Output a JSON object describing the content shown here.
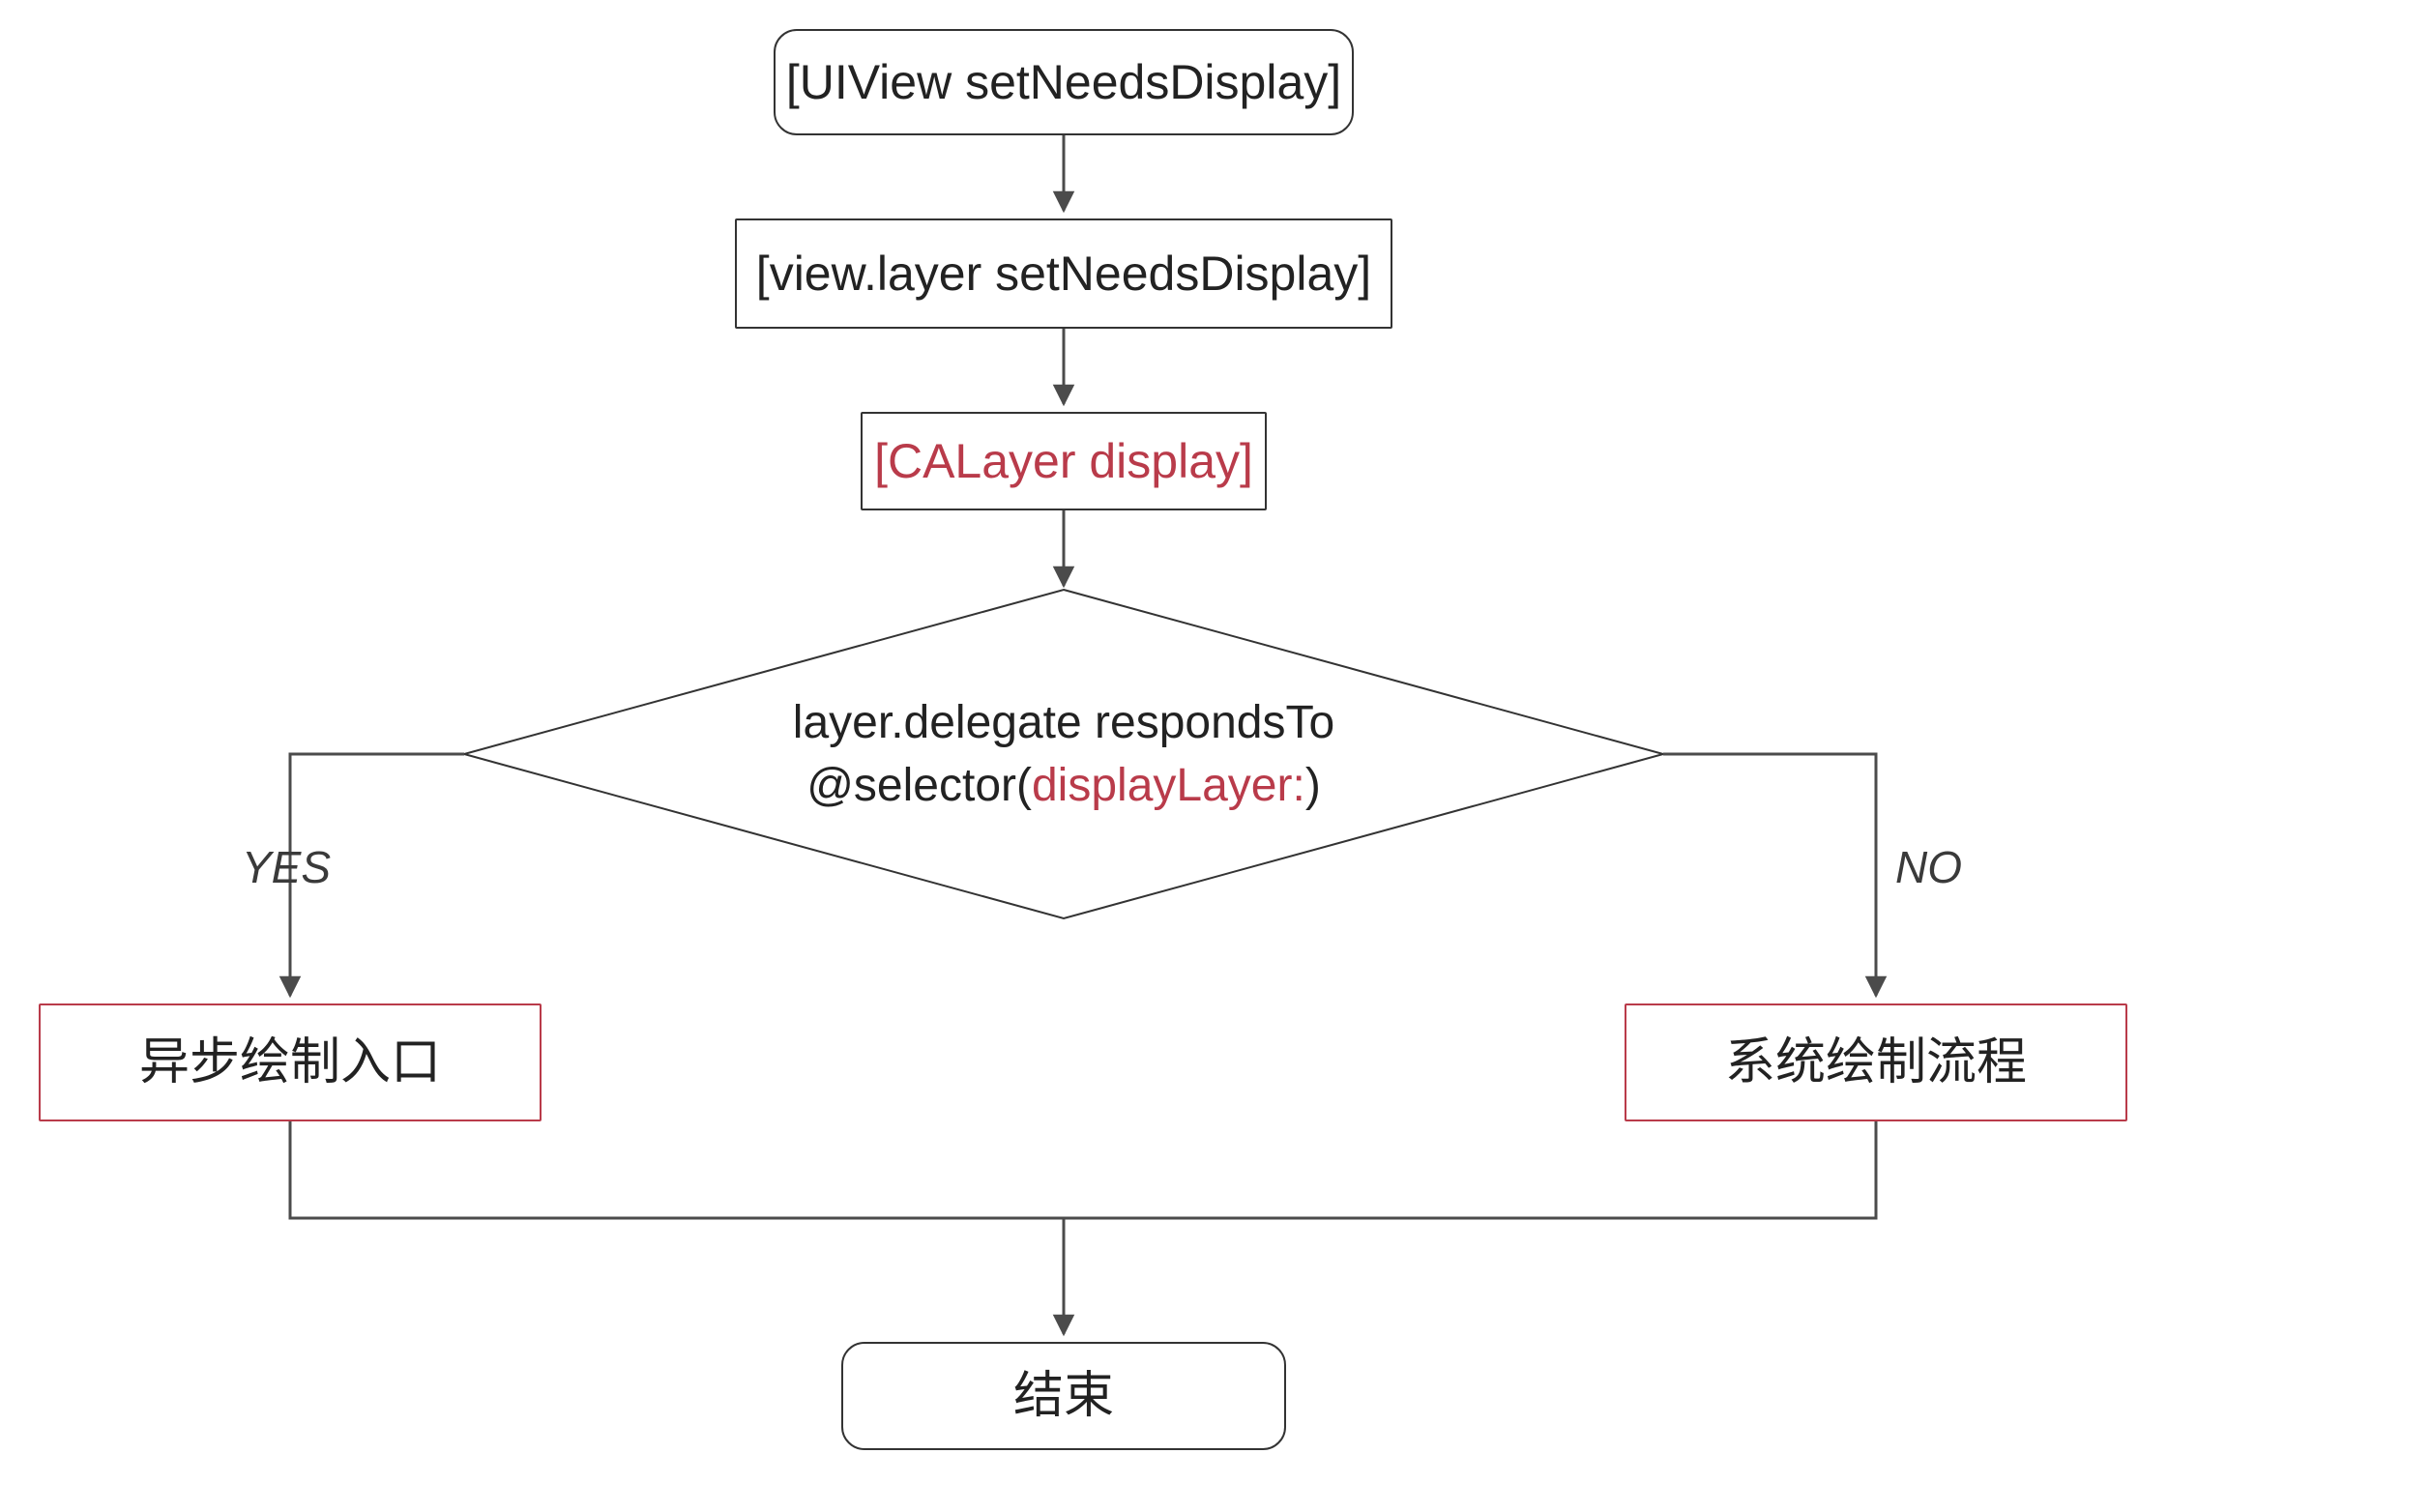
{
  "nodes": {
    "n1": "[UIView setNeedsDisplay]",
    "n2": "[view.layer setNeedsDisplay]",
    "n3": "[CALayer display]",
    "decision_line1": "layer.delegate respondsTo",
    "decision_prefix": "@selector(",
    "decision_method": "displayLayer:",
    "decision_suffix": ")",
    "yes_box": "异步绘制入口",
    "no_box": "系统绘制流程",
    "end": "结束"
  },
  "labels": {
    "yes": "YES",
    "no": "NO"
  },
  "colors": {
    "stroke": "#333333",
    "arrow": "#4b4b4b",
    "red": "#b93b4a"
  }
}
